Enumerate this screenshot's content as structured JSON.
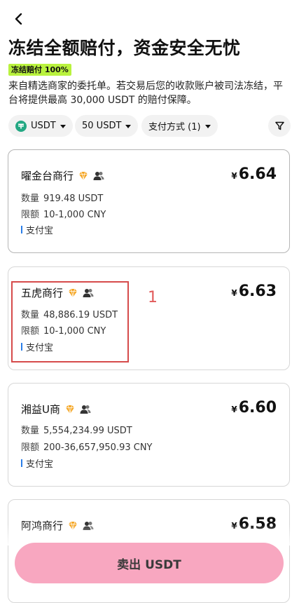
{
  "header": {
    "back_icon": "chevron-left-icon",
    "title": "冻结全额赔付，资金安全无忧",
    "badge": "冻结赔付 100%",
    "description": "来自精选商家的委托单。若交易后您的收款账户被司法冻结，平台将提供最高 30,000 USDT 的赔付保障。"
  },
  "filters": {
    "coin": "USDT",
    "amount": "50 USDT",
    "payment": "支付方式 (1)",
    "filter_icon": "filter-funnel-icon"
  },
  "orders": [
    {
      "merchant": "曜金台商行",
      "quantity_label": "数量",
      "quantity": "919.48 USDT",
      "limit_label": "限额",
      "limit": "10-1,000 CNY",
      "payment": "支付宝",
      "currency_symbol": "¥",
      "price": "6.64"
    },
    {
      "merchant": "五虎商行",
      "quantity_label": "数量",
      "quantity": "48,886.19 USDT",
      "limit_label": "限额",
      "limit": "10-1,000 CNY",
      "payment": "支付宝",
      "currency_symbol": "¥",
      "price": "6.63"
    },
    {
      "merchant": "湘益U商",
      "quantity_label": "数量",
      "quantity": "5,554,234.99 USDT",
      "limit_label": "限额",
      "limit": "200-36,657,950.93 CNY",
      "payment": "支付宝",
      "currency_symbol": "¥",
      "price": "6.60"
    },
    {
      "merchant": "阿鸿商行",
      "currency_symbol": "¥",
      "price": "6.58"
    }
  ],
  "annotation": {
    "label": "1",
    "color": "#d64b4b"
  },
  "footer": {
    "sell_label": "卖出 USDT"
  },
  "colors": {
    "badge_bg": "#b9f23e",
    "accent_pink": "#f8a7c0",
    "tether_green": "#23a883",
    "alipay_blue": "#2a7ee8",
    "diamond_orange": "#f5a623"
  }
}
